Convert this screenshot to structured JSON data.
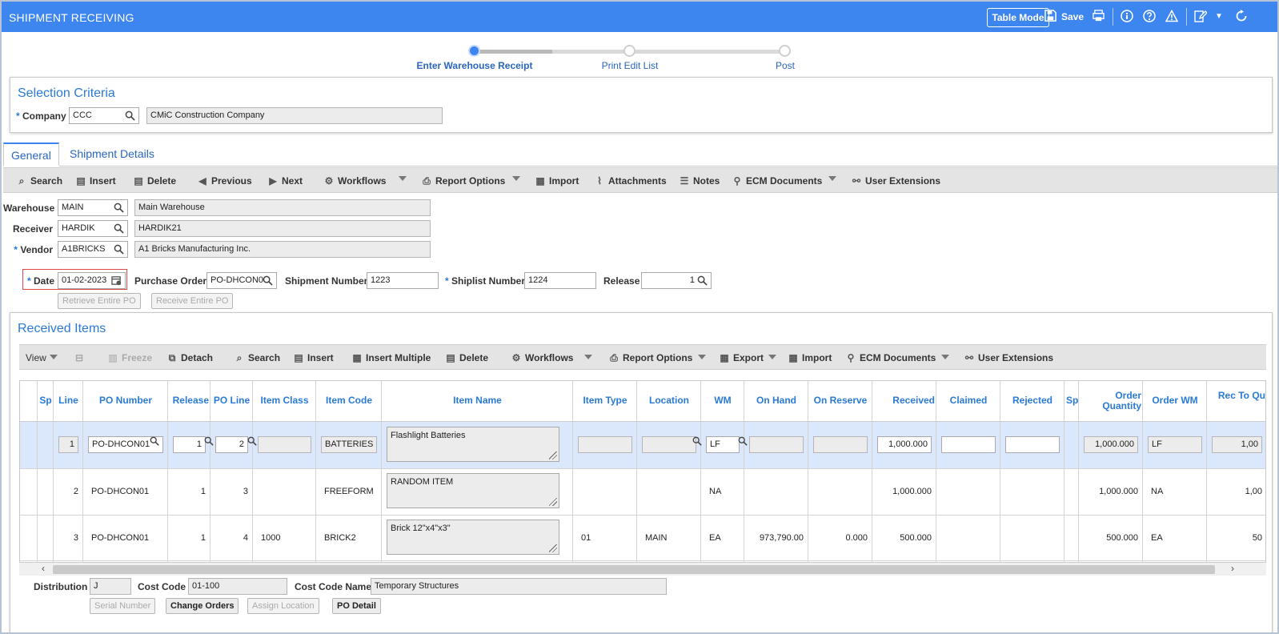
{
  "header": {
    "title": "SHIPMENT RECEIVING",
    "table_mode": "Table Mode",
    "save": "Save"
  },
  "steps": [
    {
      "label": "Enter Warehouse Receipt",
      "active": true
    },
    {
      "label": "Print Edit List",
      "active": false
    },
    {
      "label": "Post",
      "active": false
    }
  ],
  "selection": {
    "title": "Selection Criteria",
    "company_label": "Company",
    "company_code": "CCC",
    "company_name": "CMiC Construction Company"
  },
  "tabs": [
    "General",
    "Shipment Details"
  ],
  "toolbar": {
    "search": "Search",
    "insert": "Insert",
    "delete": "Delete",
    "previous": "Previous",
    "next": "Next",
    "workflows": "Workflows",
    "report_options": "Report Options",
    "import": "Import",
    "attachments": "Attachments",
    "notes": "Notes",
    "ecm": "ECM Documents",
    "user_ext": "User Extensions"
  },
  "form": {
    "warehouse_label": "Warehouse",
    "warehouse_code": "MAIN",
    "warehouse_name": "Main Warehouse",
    "receiver_label": "Receiver",
    "receiver_code": "HARDIK",
    "receiver_name": "HARDIK21",
    "vendor_label": "Vendor",
    "vendor_code": "A1BRICKS",
    "vendor_name": "A1 Bricks Manufacturing Inc.",
    "date_label": "Date",
    "date_value": "01-02-2023",
    "po_label": "Purchase Order",
    "po_value": "PO-DHCON0",
    "shipment_label": "Shipment Number",
    "shipment_value": "1223",
    "shiplist_label": "Shiplist Number",
    "shiplist_value": "1224",
    "release_label": "Release",
    "release_value": "1",
    "retrieve_po": "Retrieve Entire PO",
    "receive_po": "Receive Entire PO"
  },
  "received": {
    "title": "Received Items",
    "toolbar": {
      "view": "View",
      "freeze": "Freeze",
      "detach": "Detach",
      "search": "Search",
      "insert": "Insert",
      "insert_multiple": "Insert Multiple",
      "delete": "Delete",
      "workflows": "Workflows",
      "report_options": "Report Options",
      "export": "Export",
      "import": "Import",
      "ecm": "ECM Documents",
      "user_ext": "User Extensions"
    },
    "columns": [
      "Sp",
      "Line",
      "PO Number",
      "Release",
      "PO Line",
      "Item Class",
      "Item Code",
      "Item Name",
      "Item Type",
      "Location",
      "WM",
      "On Hand",
      "On Reserve",
      "Received",
      "Claimed",
      "Rejected",
      "Sp",
      "Order Quantity",
      "Order WM",
      "Rec To Qu"
    ],
    "rows": [
      {
        "line": "1",
        "po": "PO-DHCON01",
        "release": "1",
        "po_line": "2",
        "item_class": "",
        "item_code": "BATTERIES",
        "item_name": "Flashlight Batteries",
        "item_type": "",
        "location": "",
        "wm": "LF",
        "on_hand": "",
        "on_reserve": "",
        "received": "1,000.000",
        "claimed": "",
        "rejected": "",
        "order_qty": "1,000.000",
        "order_wm": "LF",
        "rec_qty": "1,00"
      },
      {
        "line": "2",
        "po": "PO-DHCON01",
        "release": "1",
        "po_line": "3",
        "item_class": "",
        "item_code": "FREEFORM",
        "item_name": "RANDOM ITEM",
        "item_type": "",
        "location": "",
        "wm": "NA",
        "on_hand": "",
        "on_reserve": "",
        "received": "1,000.000",
        "claimed": "",
        "rejected": "",
        "order_qty": "1,000.000",
        "order_wm": "NA",
        "rec_qty": "1,00"
      },
      {
        "line": "3",
        "po": "PO-DHCON01",
        "release": "1",
        "po_line": "4",
        "item_class": "1000",
        "item_code": "BRICK2",
        "item_name": "Brick 12\"x4\"x3\"",
        "item_type": "01",
        "location": "MAIN",
        "wm": "EA",
        "on_hand": "973,790.00",
        "on_reserve": "0.000",
        "received": "500.000",
        "claimed": "",
        "rejected": "",
        "order_qty": "500.000",
        "order_wm": "EA",
        "rec_qty": "50"
      }
    ]
  },
  "bottom": {
    "distribution_label": "Distribution",
    "distribution_value": "J",
    "cost_code_label": "Cost Code",
    "cost_code_value": "01-100",
    "cost_code_name_label": "Cost Code Name",
    "cost_code_name_value": "Temporary Structures",
    "serial_number": "Serial Number",
    "change_orders": "Change Orders",
    "assign_location": "Assign Location",
    "po_detail": "PO Detail"
  },
  "colors": {
    "accent": "#3d86f0",
    "row_selected": "#dbe8fb"
  }
}
